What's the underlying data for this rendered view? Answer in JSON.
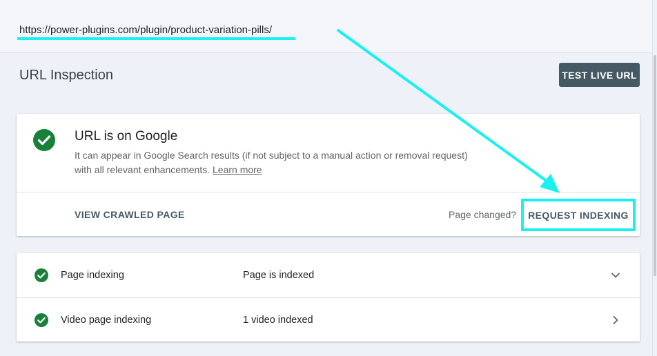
{
  "header": {
    "url": "https://power-plugins.com/plugin/product-variation-pills/"
  },
  "page": {
    "title": "URL Inspection",
    "test_live_url_label": "TEST LIVE URL"
  },
  "status_card": {
    "title": "URL is on Google",
    "description": "It can appear in Google Search results (if not subject to a manual action or removal request) with all relevant enhancements.",
    "learn_more": "Learn more",
    "view_crawled_label": "VIEW CRAWLED PAGE",
    "page_changed": "Page changed?",
    "request_indexing_label": "REQUEST INDEXING"
  },
  "details": {
    "rows": [
      {
        "label": "Page indexing",
        "value": "Page is indexed",
        "chevron": "chevron-down-icon"
      },
      {
        "label": "Video page indexing",
        "value": "1 video indexed",
        "chevron": "chevron-right-icon"
      }
    ]
  },
  "colors": {
    "success_green": "#188038",
    "highlight_cyan": "#19f0f0",
    "button_dark": "#455a64",
    "background": "#eef1f8"
  }
}
